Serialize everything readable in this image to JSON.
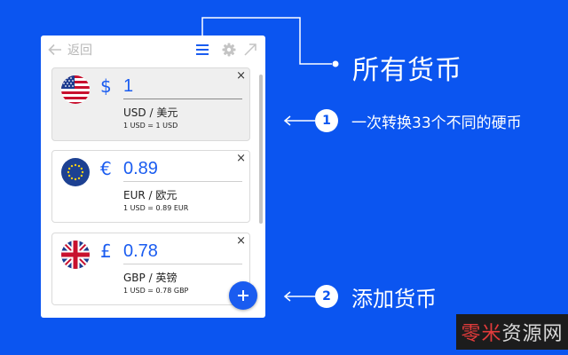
{
  "toolbar": {
    "back_label": "返回",
    "icons": [
      "arrow-left-icon",
      "list-icon",
      "gear-icon",
      "expand-icon"
    ]
  },
  "currencies": [
    {
      "flag": "us-flag-icon",
      "symbol": "$",
      "amount": "1",
      "code_name": "USD / 美元",
      "rate": "1 USD = 1 USD",
      "active": true
    },
    {
      "flag": "eu-flag-icon",
      "symbol": "€",
      "amount": "0.89",
      "code_name": "EUR / 欧元",
      "rate": "1 USD = 0.89 EUR",
      "active": false
    },
    {
      "flag": "uk-flag-icon",
      "symbol": "£",
      "amount": "0.78",
      "code_name": "GBP / 英镑",
      "rate": "1 USD = 0.78 GBP",
      "active": false
    }
  ],
  "remove_label": "×",
  "fab_icon": "plus-icon",
  "callouts": {
    "headline": "所有货币",
    "feature1_num": "1",
    "feature1": "一次转换33个不同的硬币",
    "feature2_num": "2",
    "feature2": "添加货币"
  },
  "watermark": {
    "part_a": "零米",
    "part_b": "资源网"
  },
  "colors": {
    "background": "#0b55f0",
    "accent": "#1a5cf0",
    "panel": "#ffffff",
    "active_card": "#efefef"
  }
}
